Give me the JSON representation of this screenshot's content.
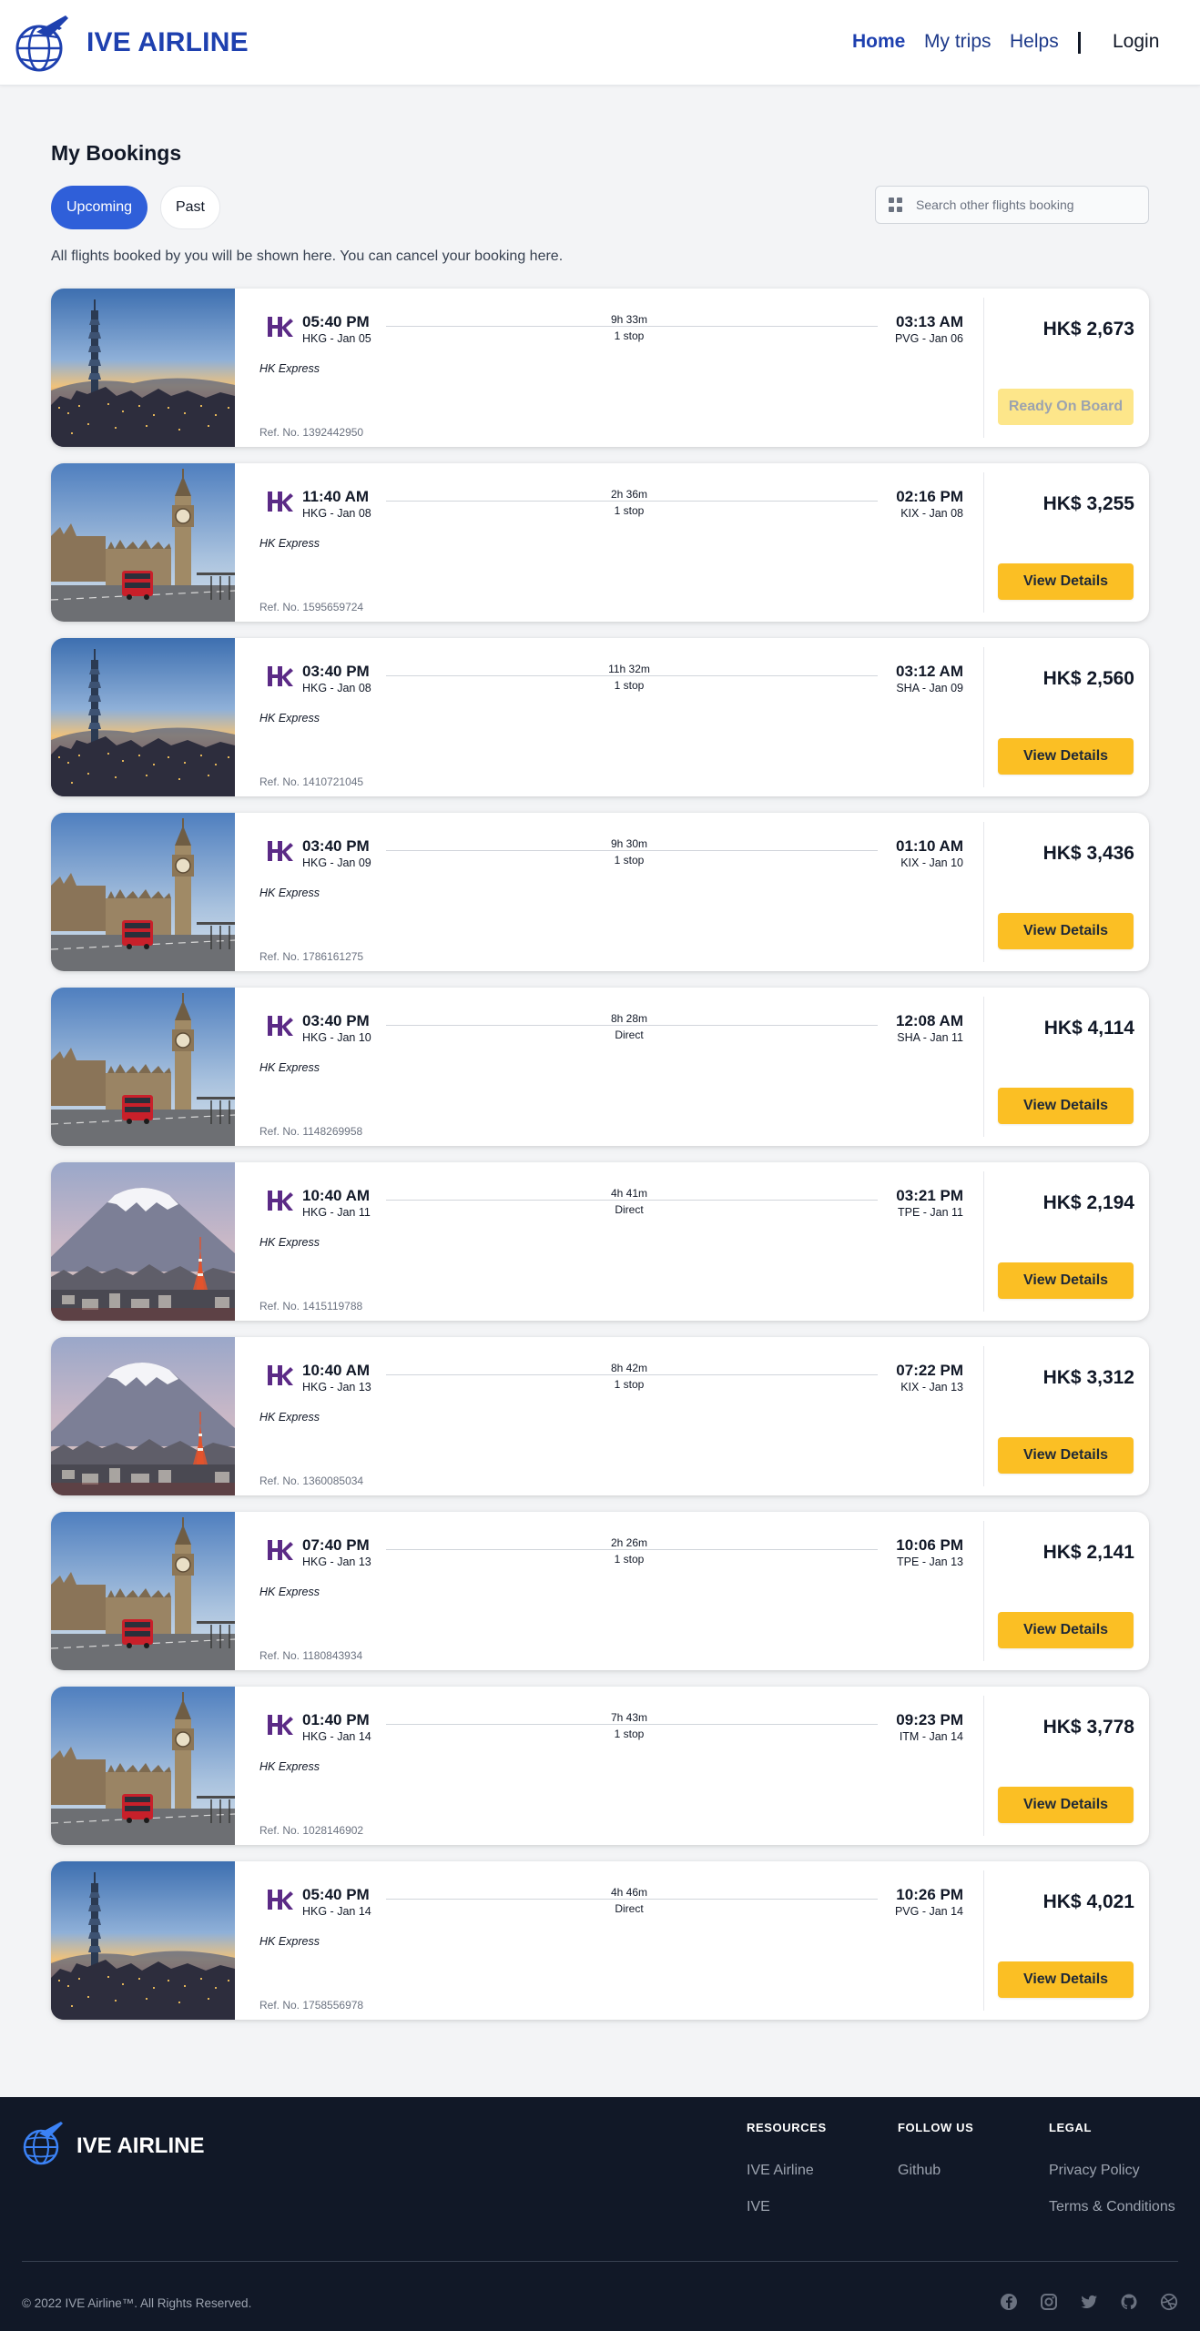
{
  "header": {
    "brand": "IVE AIRLINE",
    "nav": {
      "home": "Home",
      "trips": "My trips",
      "helps": "Helps",
      "login": "Login"
    }
  },
  "page": {
    "title": "My Bookings",
    "tabs": {
      "upcoming": "Upcoming",
      "past": "Past"
    },
    "search_placeholder": "Search other flights booking",
    "intro": "All flights booked by you will be shown here. You can cancel your booking here."
  },
  "bookings": [
    {
      "image": "taipei",
      "dep_time": "05:40 PM",
      "dep_place": "HKG - Jan 05",
      "duration": "9h 33m",
      "stops": "1 stop",
      "arr_time": "03:13 AM",
      "arr_place": "PVG - Jan 06",
      "airline": "HK Express",
      "ref": "Ref. No. 1392442950",
      "price": "HK$ 2,673",
      "action": "Ready On Board",
      "action_disabled": true
    },
    {
      "image": "london",
      "dep_time": "11:40 AM",
      "dep_place": "HKG - Jan 08",
      "duration": "2h 36m",
      "stops": "1 stop",
      "arr_time": "02:16 PM",
      "arr_place": "KIX - Jan 08",
      "airline": "HK Express",
      "ref": "Ref. No. 1595659724",
      "price": "HK$ 3,255",
      "action": "View Details",
      "action_disabled": false
    },
    {
      "image": "taipei",
      "dep_time": "03:40 PM",
      "dep_place": "HKG - Jan 08",
      "duration": "11h 32m",
      "stops": "1 stop",
      "arr_time": "03:12 AM",
      "arr_place": "SHA - Jan 09",
      "airline": "HK Express",
      "ref": "Ref. No. 1410721045",
      "price": "HK$ 2,560",
      "action": "View Details",
      "action_disabled": false
    },
    {
      "image": "london",
      "dep_time": "03:40 PM",
      "dep_place": "HKG - Jan 09",
      "duration": "9h 30m",
      "stops": "1 stop",
      "arr_time": "01:10 AM",
      "arr_place": "KIX - Jan 10",
      "airline": "HK Express",
      "ref": "Ref. No. 1786161275",
      "price": "HK$ 3,436",
      "action": "View Details",
      "action_disabled": false
    },
    {
      "image": "london",
      "dep_time": "03:40 PM",
      "dep_place": "HKG - Jan 10",
      "duration": "8h 28m",
      "stops": "Direct",
      "arr_time": "12:08 AM",
      "arr_place": "SHA - Jan 11",
      "airline": "HK Express",
      "ref": "Ref. No. 1148269958",
      "price": "HK$ 4,114",
      "action": "View Details",
      "action_disabled": false
    },
    {
      "image": "tokyo",
      "dep_time": "10:40 AM",
      "dep_place": "HKG - Jan 11",
      "duration": "4h 41m",
      "stops": "Direct",
      "arr_time": "03:21 PM",
      "arr_place": "TPE - Jan 11",
      "airline": "HK Express",
      "ref": "Ref. No. 1415119788",
      "price": "HK$ 2,194",
      "action": "View Details",
      "action_disabled": false
    },
    {
      "image": "tokyo",
      "dep_time": "10:40 AM",
      "dep_place": "HKG - Jan 13",
      "duration": "8h 42m",
      "stops": "1 stop",
      "arr_time": "07:22 PM",
      "arr_place": "KIX - Jan 13",
      "airline": "HK Express",
      "ref": "Ref. No. 1360085034",
      "price": "HK$ 3,312",
      "action": "View Details",
      "action_disabled": false
    },
    {
      "image": "london",
      "dep_time": "07:40 PM",
      "dep_place": "HKG - Jan 13",
      "duration": "2h 26m",
      "stops": "1 stop",
      "arr_time": "10:06 PM",
      "arr_place": "TPE - Jan 13",
      "airline": "HK Express",
      "ref": "Ref. No. 1180843934",
      "price": "HK$ 2,141",
      "action": "View Details",
      "action_disabled": false
    },
    {
      "image": "london",
      "dep_time": "01:40 PM",
      "dep_place": "HKG - Jan 14",
      "duration": "7h 43m",
      "stops": "1 stop",
      "arr_time": "09:23 PM",
      "arr_place": "ITM - Jan 14",
      "airline": "HK Express",
      "ref": "Ref. No. 1028146902",
      "price": "HK$ 3,778",
      "action": "View Details",
      "action_disabled": false
    },
    {
      "image": "taipei",
      "dep_time": "05:40 PM",
      "dep_place": "HKG - Jan 14",
      "duration": "4h 46m",
      "stops": "Direct",
      "arr_time": "10:26 PM",
      "arr_place": "PVG - Jan 14",
      "airline": "HK Express",
      "ref": "Ref. No. 1758556978",
      "price": "HK$ 4,021",
      "action": "View Details",
      "action_disabled": false
    }
  ],
  "footer": {
    "brand": "IVE AIRLINE",
    "resources": {
      "title": "RESOURCES",
      "links": [
        "IVE Airline",
        "IVE"
      ]
    },
    "follow": {
      "title": "FOLLOW US",
      "links": [
        "Github"
      ]
    },
    "legal": {
      "title": "LEGAL",
      "links": [
        "Privacy Policy",
        "Terms & Conditions"
      ]
    },
    "copyright": "© 2022 IVE Airline™. All Rights Reserved.",
    "social_icons": [
      "facebook-icon",
      "instagram-icon",
      "twitter-icon",
      "github-icon",
      "dribbble-icon"
    ]
  },
  "colors": {
    "brand_blue": "#1e40af",
    "tab_active": "#2f5fd9",
    "action_yellow": "#fbbf24",
    "action_disabled": "#fde68a",
    "hk_express_purple": "#5b2a86",
    "footer_bg": "#111827"
  }
}
